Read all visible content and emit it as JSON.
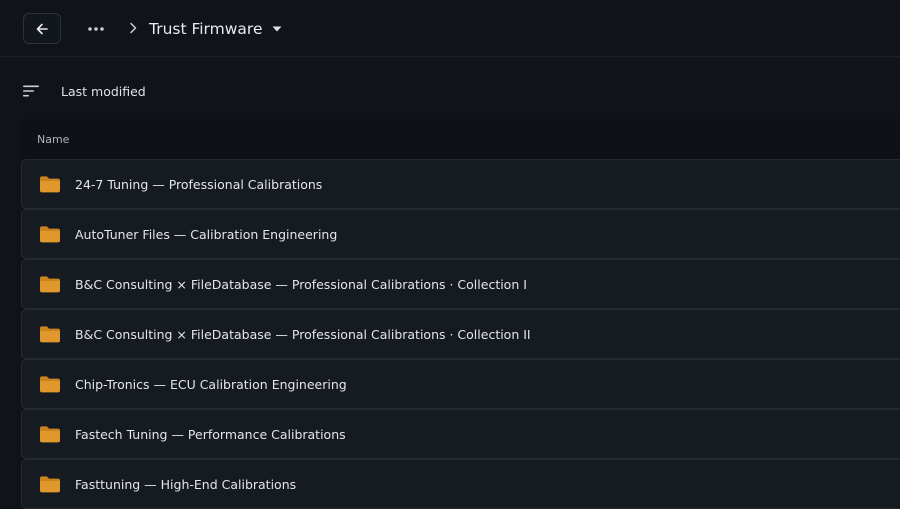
{
  "header": {
    "breadcrumb_current": "Trust Firmware"
  },
  "toolbar": {
    "sort_label": "Last modified"
  },
  "table": {
    "column_name": "Name",
    "rows": [
      {
        "name": "24-7 Tuning — Professional Calibrations"
      },
      {
        "name": "AutoTuner Files — Calibration Engineering"
      },
      {
        "name": "B&C Consulting × FileDatabase — Professional Calibrations · Collection I"
      },
      {
        "name": "B&C Consulting × FileDatabase — Professional Calibrations · Collection II"
      },
      {
        "name": "Chip-Tronics — ECU Calibration Engineering"
      },
      {
        "name": "Fastech Tuning — Performance Calibrations"
      },
      {
        "name": "Fasttuning — High-End Calibrations"
      }
    ]
  },
  "colors": {
    "background": "#101418",
    "row_background": "#161b21",
    "folder": "#e0982c"
  }
}
